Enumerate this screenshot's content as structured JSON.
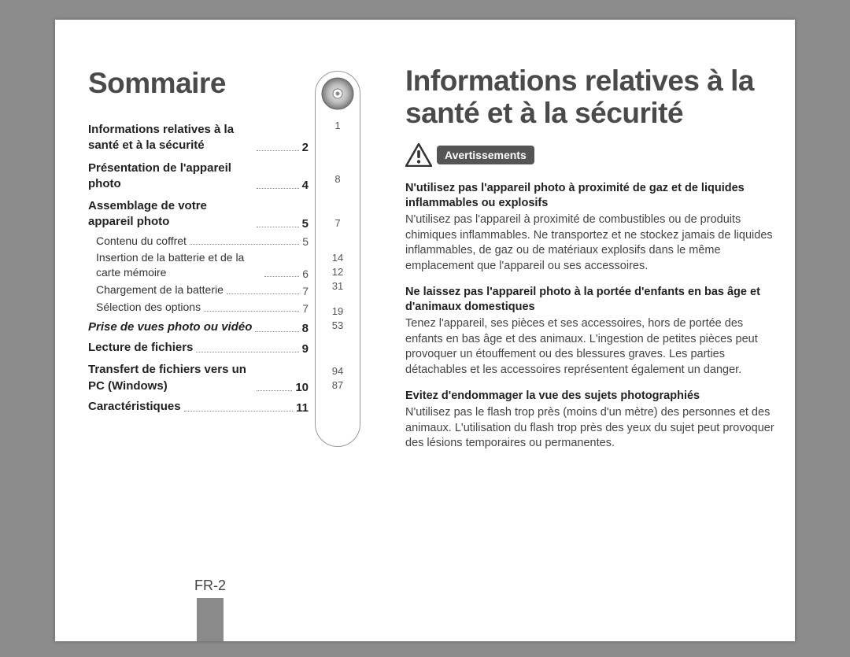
{
  "left_title": "Sommaire",
  "right_title": "Informations relatives à la santé et à la sécurité",
  "warn_label": "Avertissements",
  "page_label": "FR-2",
  "toc": [
    {
      "label": "Informations relatives à la santé et à la sécurité",
      "page": "2",
      "style": "bold"
    },
    {
      "label": "Présentation de l'appareil photo",
      "page": "4",
      "style": "bold"
    },
    {
      "label": "Assemblage de votre appareil photo",
      "page": "5",
      "style": "bold"
    },
    {
      "label": "Contenu du coffret",
      "page": "5",
      "style": "sub"
    },
    {
      "label": "Insertion de la batterie et de la carte mémoire",
      "page": "6",
      "style": "sub"
    },
    {
      "label": "Chargement de la batterie",
      "page": "7",
      "style": "sub"
    },
    {
      "label": "Sélection des options",
      "page": "7",
      "style": "sub"
    },
    {
      "label": "Prise de vues photo ou vidéo",
      "page": "8",
      "style": "italic"
    },
    {
      "label": "Lecture de fichiers",
      "page": "9",
      "style": "bold"
    },
    {
      "label": "Transfert de fichiers vers un PC (Windows)",
      "page": "10",
      "style": "bold"
    },
    {
      "label": "Caractéristiques",
      "page": "11",
      "style": "bold"
    }
  ],
  "cd_numbers": [
    "1",
    "8",
    "",
    "7",
    "",
    "14",
    "12",
    "31",
    "19",
    "53",
    "",
    "94",
    "87"
  ],
  "sections": [
    {
      "heading": "N'utilisez pas l'appareil photo à proximité de gaz et de liquides inflammables ou explosifs",
      "body": "N'utilisez pas l'appareil à proximité de combustibles ou de produits chimiques inflammables. Ne transportez et ne stockez jamais de liquides inflammables, de gaz ou de matériaux explosifs dans le même emplacement que l'appareil ou ses accessoires."
    },
    {
      "heading": "Ne laissez pas l'appareil photo à la portée d'enfants en bas âge et d'animaux domestiques",
      "body": "Tenez l'appareil, ses pièces et ses accessoires, hors de portée des enfants en bas âge et des animaux. L'ingestion de petites pièces peut provoquer un étouffement ou des blessures graves. Les parties détachables et les accessoires représentent également un danger."
    },
    {
      "heading": "Evitez d'endommager la vue des sujets photographiés",
      "body": "N'utilisez pas le flash trop près (moins d'un mètre) des personnes et des animaux. L'utilisation du flash trop près des yeux du sujet peut provoquer des lésions temporaires ou permanentes."
    }
  ]
}
